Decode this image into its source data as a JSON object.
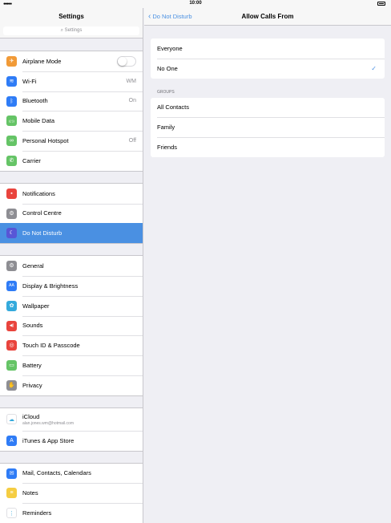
{
  "status": {
    "time": "10:00",
    "signal": "●●●●●"
  },
  "sidebar": {
    "title": "Settings",
    "search_placeholder": "Settings",
    "groups": [
      [
        {
          "label": "Airplane Mode",
          "icon": "airplane-icon",
          "color": "#f19a37",
          "glyph": "✈",
          "toggle": true
        },
        {
          "label": "Wi-Fi",
          "icon": "wifi-icon",
          "color": "#2f7cf6",
          "glyph": "≋",
          "value": "WM"
        },
        {
          "label": "Bluetooth",
          "icon": "bluetooth-icon",
          "color": "#2f7cf6",
          "glyph": "ᛒ",
          "value": "On"
        },
        {
          "label": "Mobile Data",
          "icon": "antenna-icon",
          "color": "#65c466",
          "glyph": "((·))"
        },
        {
          "label": "Personal Hotspot",
          "icon": "hotspot-icon",
          "color": "#65c466",
          "glyph": "∞",
          "value": "Off"
        },
        {
          "label": "Carrier",
          "icon": "phone-icon",
          "color": "#65c466",
          "glyph": "✆"
        }
      ],
      [
        {
          "label": "Notifications",
          "icon": "notifications-icon",
          "color": "#e9443d",
          "glyph": "▪"
        },
        {
          "label": "Control Centre",
          "icon": "control-centre-icon",
          "color": "#8e8e93",
          "glyph": "⚙"
        },
        {
          "label": "Do Not Disturb",
          "icon": "moon-icon",
          "color": "#5856d6",
          "glyph": "☾",
          "selected": true
        }
      ],
      [
        {
          "label": "General",
          "icon": "gear-icon",
          "color": "#8e8e93",
          "glyph": "⚙"
        },
        {
          "label": "Display & Brightness",
          "icon": "display-icon",
          "color": "#2f7cf6",
          "glyph": "AA"
        },
        {
          "label": "Wallpaper",
          "icon": "wallpaper-icon",
          "color": "#34aadc",
          "glyph": "✿"
        },
        {
          "label": "Sounds",
          "icon": "speaker-icon",
          "color": "#e9443d",
          "glyph": "◀)"
        },
        {
          "label": "Touch ID & Passcode",
          "icon": "fingerprint-icon",
          "color": "#e9443d",
          "glyph": "◎"
        },
        {
          "label": "Battery",
          "icon": "battery-icon",
          "color": "#65c466",
          "glyph": "▭"
        },
        {
          "label": "Privacy",
          "icon": "hand-icon",
          "color": "#8e8e93",
          "glyph": "✋"
        }
      ],
      [
        {
          "label": "iCloud",
          "sublabel": "alan.jones.wm@hotmail.com",
          "icon": "cloud-icon",
          "color": "#ffffff",
          "glyph": "☁"
        },
        {
          "label": "iTunes & App Store",
          "icon": "app-store-icon",
          "color": "#2f7cf6",
          "glyph": "A"
        }
      ],
      [
        {
          "label": "Mail, Contacts, Calendars",
          "icon": "mail-icon",
          "color": "#2f7cf6",
          "glyph": "✉"
        },
        {
          "label": "Notes",
          "icon": "notes-icon",
          "color": "#f5cd42",
          "glyph": "≡"
        },
        {
          "label": "Reminders",
          "icon": "reminders-icon",
          "color": "#ffffff",
          "glyph": "⋮"
        }
      ]
    ]
  },
  "detail": {
    "back_label": "Do Not Disturb",
    "title": "Allow Calls From",
    "options": [
      {
        "label": "Everyone",
        "checked": false
      },
      {
        "label": "No One",
        "checked": true
      }
    ],
    "groups_label": "GROUPS",
    "groups": [
      {
        "label": "All Contacts"
      },
      {
        "label": "Family"
      },
      {
        "label": "Friends"
      }
    ]
  },
  "colors": {
    "accent": "#4a90e2",
    "selected_row": "#4a90e2"
  }
}
